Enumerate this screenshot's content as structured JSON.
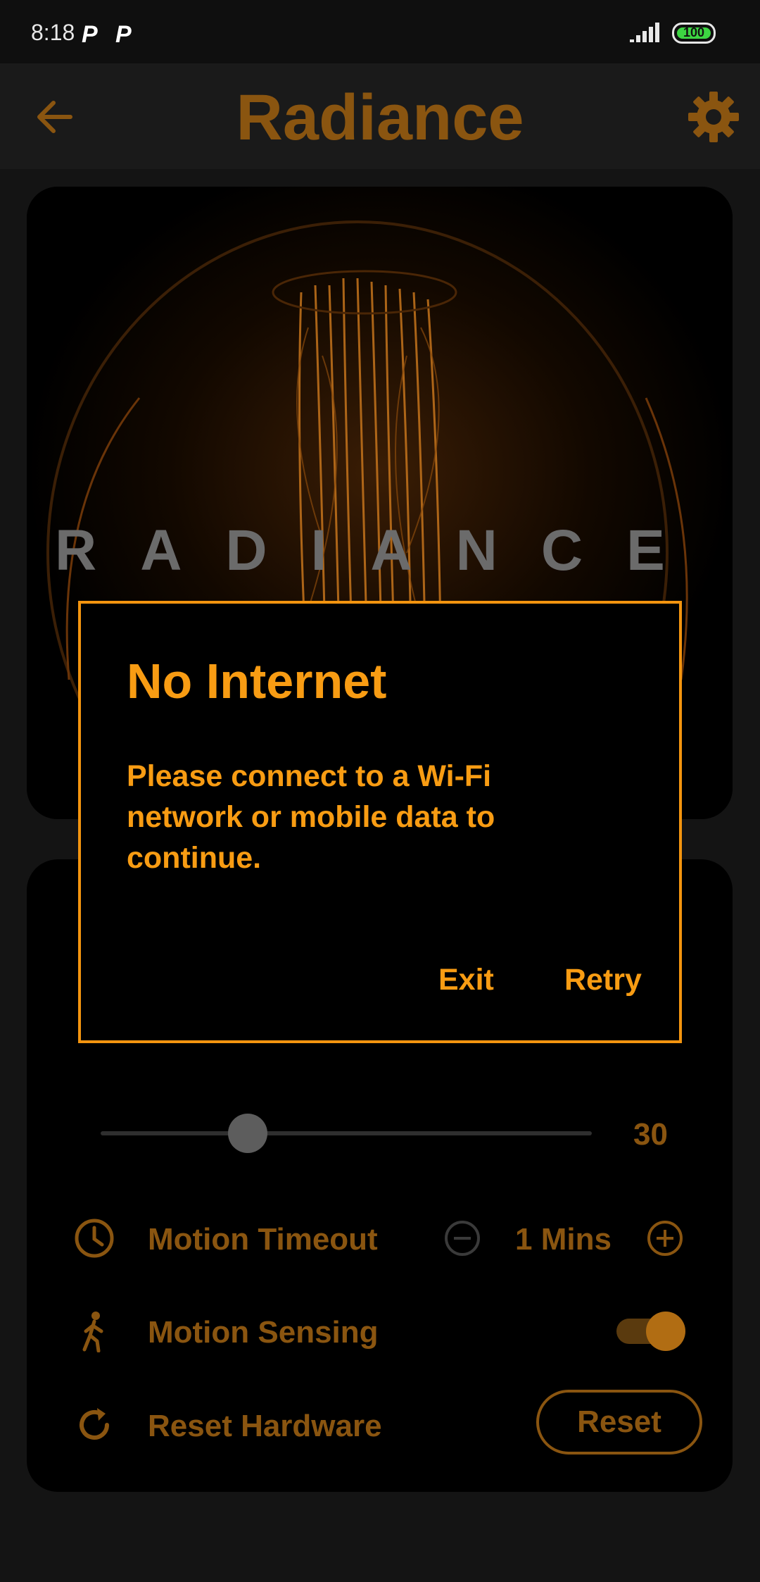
{
  "status_bar": {
    "time": "8:18",
    "notification_icons": [
      "P",
      "P"
    ],
    "battery": "100"
  },
  "app_bar": {
    "title": "Radiance"
  },
  "hero": {
    "brand_word": "RADIANCE"
  },
  "controls": {
    "slider_value": "30",
    "slider_fraction": 0.3,
    "motion_timeout": {
      "label": "Motion Timeout",
      "value": "1 Mins"
    },
    "motion_sensing": {
      "label": "Motion Sensing",
      "enabled": true
    },
    "reset_hardware": {
      "label": "Reset Hardware",
      "button": "Reset"
    }
  },
  "dialog": {
    "title": "No Internet",
    "message": "Please connect to a Wi-Fi network or mobile data to continue.",
    "exit_label": "Exit",
    "retry_label": "Retry"
  },
  "colors": {
    "accent": "#f89c13",
    "dimmed_accent": "#8a5510",
    "background": "#141414"
  }
}
